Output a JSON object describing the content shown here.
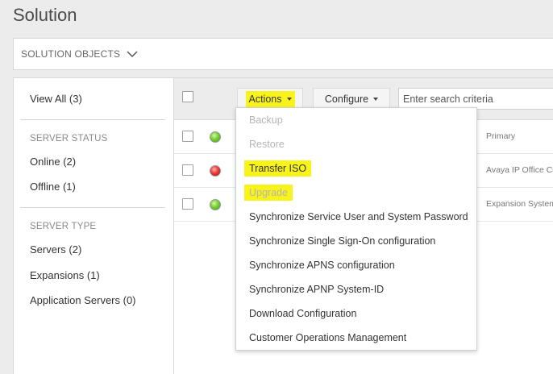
{
  "page": {
    "title": "Solution"
  },
  "objects_bar": {
    "label": "SOLUTION OBJECTS",
    "icon": "chevron-down-icon"
  },
  "sidebar": {
    "view_all": "View All (3)",
    "server_status": {
      "header": "SERVER STATUS",
      "items": [
        "Online (2)",
        "Offline (1)"
      ]
    },
    "server_type": {
      "header": "SERVER TYPE",
      "items": [
        "Servers (2)",
        "Expansions (1)",
        "Application Servers (0)"
      ]
    }
  },
  "toolbar": {
    "actions_label": "Actions",
    "configure_label": "Configure",
    "search_placeholder": "Enter search criteria"
  },
  "rows": [
    {
      "status": "online",
      "status_color": "#5cc22a",
      "cell": "Primary"
    },
    {
      "status": "offline",
      "status_color": "#e02424",
      "cell": "Avaya IP Office Ce"
    },
    {
      "status": "online",
      "status_color": "#5cc22a",
      "cell": "Expansion System"
    }
  ],
  "actions_menu": {
    "items": [
      {
        "label": "Backup",
        "enabled": false
      },
      {
        "label": "Restore",
        "enabled": false
      },
      {
        "label": "Transfer ISO",
        "enabled": true,
        "highlighted": true
      },
      {
        "label": "Upgrade",
        "enabled": false,
        "highlighted": true
      },
      {
        "label": "Synchronize Service User and System Password",
        "enabled": true
      },
      {
        "label": "Synchronize Single Sign-On configuration",
        "enabled": true
      },
      {
        "label": "Synchronize APNS configuration",
        "enabled": true
      },
      {
        "label": "Synchronize APNP System-ID",
        "enabled": true
      },
      {
        "label": "Download Configuration",
        "enabled": true
      },
      {
        "label": "Customer Operations Management",
        "enabled": true
      }
    ]
  },
  "colors": {
    "highlight": "#f8f31a",
    "background": "#ececec"
  }
}
